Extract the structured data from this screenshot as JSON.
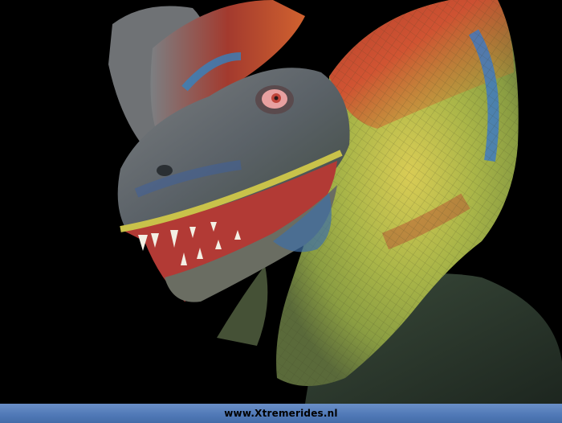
{
  "photo": {
    "subject": "dilophosaurus-statue"
  },
  "footer": {
    "caption": "www.Xtremerides.nl"
  },
  "colors": {
    "background": "#000000",
    "footer_bar": "#5680bd",
    "frill_red": "#c43a2a",
    "frill_yellow": "#c9c24a",
    "frill_blue": "#3a78c8",
    "skin_gray": "#6b6e70",
    "eye_pink": "#e8a0a0"
  }
}
